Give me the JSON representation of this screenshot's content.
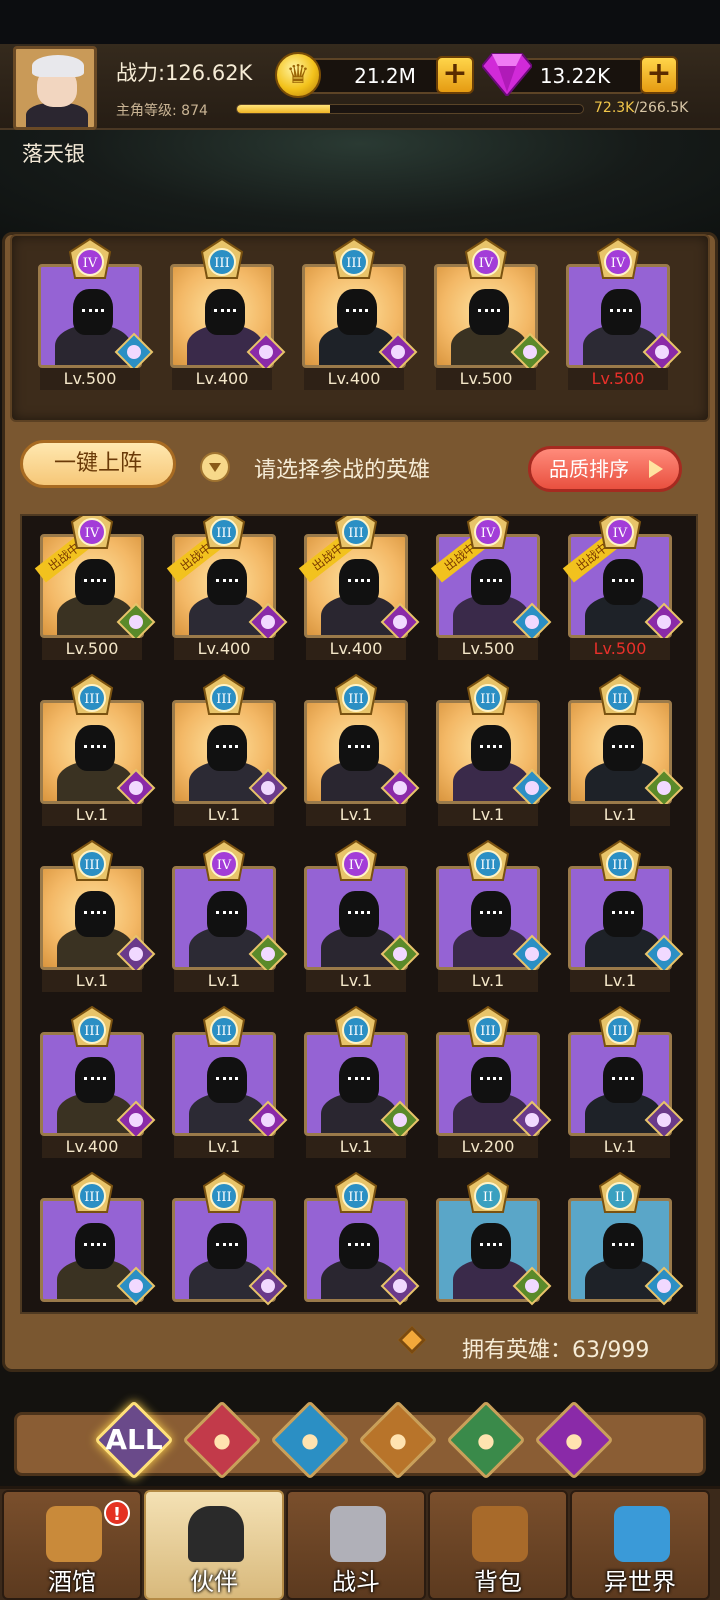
{
  "player": {
    "name": "落天银",
    "power": "战力:126.62K",
    "level_label": "主角等级: 874",
    "exp_current": "72.3K",
    "exp_max": "/266.5K",
    "exp_fraction": 0.27
  },
  "currency": {
    "gold": "21.2M",
    "gems": "13.22K",
    "plus": "+"
  },
  "lineup": [
    {
      "rank": "IV",
      "lvl": "Lv.500",
      "bg": "purple",
      "faction": "merfolk",
      "lvl_red": false
    },
    {
      "rank": "III",
      "lvl": "Lv.400",
      "bg": "gold",
      "faction": "demon",
      "lvl_red": false
    },
    {
      "rank": "III",
      "lvl": "Lv.400",
      "bg": "gold",
      "faction": "demon",
      "lvl_red": false
    },
    {
      "rank": "IV",
      "lvl": "Lv.500",
      "bg": "gold",
      "faction": "elf",
      "lvl_red": false
    },
    {
      "rank": "IV",
      "lvl": "Lv.500",
      "bg": "purple",
      "faction": "demon",
      "lvl_red": true
    }
  ],
  "controls": {
    "one_click": "一键上阵",
    "prompt": "请选择参战的英雄",
    "sort": "品质排序"
  },
  "deploy_tag": "出战中",
  "roster": [
    {
      "rank": "IV",
      "lvl": "Lv.500",
      "bg": "gold",
      "faction": "elf",
      "deployed": true,
      "lvl_red": false
    },
    {
      "rank": "III",
      "lvl": "Lv.400",
      "bg": "gold",
      "faction": "demon",
      "deployed": true,
      "lvl_red": false
    },
    {
      "rank": "III",
      "lvl": "Lv.400",
      "bg": "gold",
      "faction": "demon",
      "deployed": true,
      "lvl_red": false
    },
    {
      "rank": "IV",
      "lvl": "Lv.500",
      "bg": "purple",
      "faction": "merfolk",
      "deployed": true,
      "lvl_red": false
    },
    {
      "rank": "IV",
      "lvl": "Lv.500",
      "bg": "purple",
      "faction": "demon",
      "deployed": true,
      "lvl_red": true
    },
    {
      "rank": "III",
      "lvl": "Lv.1",
      "bg": "gold",
      "faction": "demon",
      "deployed": false,
      "lvl_red": false
    },
    {
      "rank": "III",
      "lvl": "Lv.1",
      "bg": "gold",
      "faction": "human",
      "deployed": false,
      "lvl_red": false
    },
    {
      "rank": "III",
      "lvl": "Lv.1",
      "bg": "gold",
      "faction": "demon",
      "deployed": false,
      "lvl_red": false
    },
    {
      "rank": "III",
      "lvl": "Lv.1",
      "bg": "gold",
      "faction": "merfolk",
      "deployed": false,
      "lvl_red": false
    },
    {
      "rank": "III",
      "lvl": "Lv.1",
      "bg": "gold",
      "faction": "elf",
      "deployed": false,
      "lvl_red": false
    },
    {
      "rank": "III",
      "lvl": "Lv.1",
      "bg": "gold",
      "faction": "human",
      "deployed": false,
      "lvl_red": false
    },
    {
      "rank": "IV",
      "lvl": "Lv.1",
      "bg": "purple",
      "faction": "elf",
      "deployed": false,
      "lvl_red": false
    },
    {
      "rank": "IV",
      "lvl": "Lv.1",
      "bg": "purple",
      "faction": "elf",
      "deployed": false,
      "lvl_red": false
    },
    {
      "rank": "III",
      "lvl": "Lv.1",
      "bg": "purple",
      "faction": "merfolk",
      "deployed": false,
      "lvl_red": false
    },
    {
      "rank": "III",
      "lvl": "Lv.1",
      "bg": "purple",
      "faction": "merfolk",
      "deployed": false,
      "lvl_red": false
    },
    {
      "rank": "III",
      "lvl": "Lv.400",
      "bg": "purple",
      "faction": "demon",
      "deployed": false,
      "lvl_red": false
    },
    {
      "rank": "III",
      "lvl": "Lv.1",
      "bg": "purple",
      "faction": "demon",
      "deployed": false,
      "lvl_red": false
    },
    {
      "rank": "III",
      "lvl": "Lv.1",
      "bg": "purple",
      "faction": "elf",
      "deployed": false,
      "lvl_red": false
    },
    {
      "rank": "III",
      "lvl": "Lv.200",
      "bg": "purple",
      "faction": "human",
      "deployed": false,
      "lvl_red": false
    },
    {
      "rank": "III",
      "lvl": "Lv.1",
      "bg": "purple",
      "faction": "human",
      "deployed": false,
      "lvl_red": false
    },
    {
      "rank": "III",
      "lvl": "",
      "bg": "purple",
      "faction": "merfolk",
      "deployed": false,
      "lvl_red": false
    },
    {
      "rank": "III",
      "lvl": "",
      "bg": "purple",
      "faction": "human",
      "deployed": false,
      "lvl_red": false
    },
    {
      "rank": "III",
      "lvl": "",
      "bg": "purple",
      "faction": "human",
      "deployed": false,
      "lvl_red": false
    },
    {
      "rank": "II",
      "lvl": "",
      "bg": "blue",
      "faction": "elf",
      "deployed": false,
      "lvl_red": false
    },
    {
      "rank": "II",
      "lvl": "",
      "bg": "blue",
      "faction": "merfolk",
      "deployed": false,
      "lvl_red": false
    }
  ],
  "owned": {
    "label": "拥有英雄：63/999"
  },
  "filters": [
    {
      "id": "all",
      "label": "ALL",
      "icon": "all-filter-icon",
      "color": "#6a4a8a"
    },
    {
      "id": "human",
      "label": "",
      "icon": "human-warrior-icon",
      "color": "#c23a4a"
    },
    {
      "id": "merfolk",
      "label": "",
      "icon": "merfolk-icon",
      "color": "#2b8fc4"
    },
    {
      "id": "beast",
      "label": "",
      "icon": "lion-icon",
      "color": "#b8742a"
    },
    {
      "id": "elf",
      "label": "",
      "icon": "elf-icon",
      "color": "#3a8a4a"
    },
    {
      "id": "demon",
      "label": "",
      "icon": "demon-icon",
      "color": "#8a2aa8"
    }
  ],
  "nav": [
    {
      "id": "tavern",
      "label": "酒馆",
      "icon": "beer-mug-icon",
      "active": false
    },
    {
      "id": "partner",
      "label": "伙伴",
      "icon": "character-icon",
      "active": true
    },
    {
      "id": "battle",
      "label": "战斗",
      "icon": "crossed-swords-icon",
      "active": false
    },
    {
      "id": "bag",
      "label": "背包",
      "icon": "backpack-icon",
      "active": false
    },
    {
      "id": "otherworld",
      "label": "异世界",
      "icon": "portal-icon",
      "active": false
    }
  ],
  "alert_badge": "!"
}
